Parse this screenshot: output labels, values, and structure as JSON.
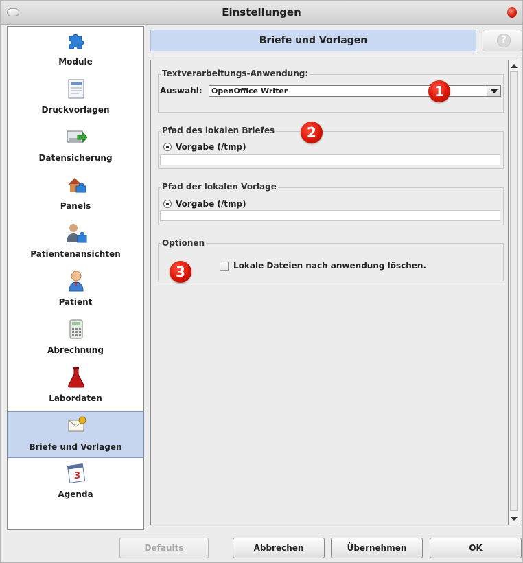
{
  "window": {
    "title": "Einstellungen"
  },
  "sidebar": {
    "items": [
      {
        "label": "Module",
        "icon": "puzzle-icon"
      },
      {
        "label": "Druckvorlagen",
        "icon": "document-icon"
      },
      {
        "label": "Datensicherung",
        "icon": "backup-icon"
      },
      {
        "label": "Panels",
        "icon": "panels-icon"
      },
      {
        "label": "Patientenansichten",
        "icon": "patient-views-icon"
      },
      {
        "label": "Patient",
        "icon": "person-icon"
      },
      {
        "label": "Abrechnung",
        "icon": "calculator-icon"
      },
      {
        "label": "Labordaten",
        "icon": "flask-icon"
      },
      {
        "label": "Briefe und Vorlagen",
        "icon": "letter-icon",
        "selected": true
      },
      {
        "label": "Agenda",
        "icon": "calendar-icon"
      }
    ]
  },
  "panel": {
    "title": "Briefe und Vorlagen",
    "help_label": "?"
  },
  "text_app": {
    "legend": "Textverarbeitungs-Anwendung:",
    "auswahl_label": "Auswahl:",
    "selected_value": "OpenOffice Writer"
  },
  "letter_path": {
    "legend": "Pfad des lokalen Briefes",
    "radio_label": "Vorgabe (/tmp)",
    "path_value": ""
  },
  "template_path": {
    "legend": "Pfad der lokalen Vorlage",
    "radio_label": "Vorgabe (/tmp)",
    "path_value": ""
  },
  "options": {
    "legend": "Optionen",
    "checkbox_label": "Lokale Dateien nach anwendung löschen.",
    "checked": false
  },
  "markers": [
    "1",
    "2",
    "3"
  ],
  "footer": {
    "defaults": "Defaults",
    "cancel": "Abbrechen",
    "apply": "Übernehmen",
    "ok": "OK"
  },
  "colors": {
    "accent_selected": "#c7d6ee",
    "marker_red": "#d81607"
  }
}
